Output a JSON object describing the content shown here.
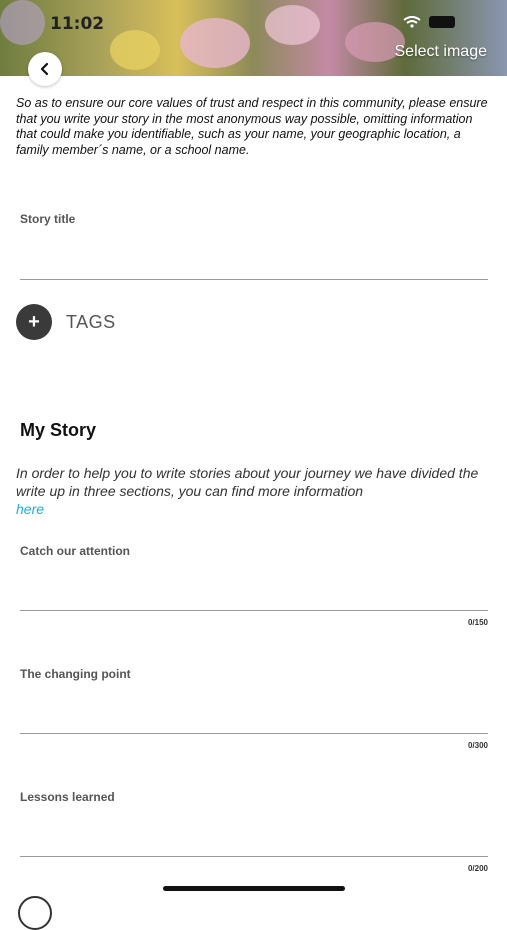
{
  "status_bar": {
    "time": "11:02"
  },
  "header": {
    "select_image_label": "Select image"
  },
  "intro_text": "So as to ensure our core values of trust and respect in this community, please ensure that you write your story in the most anonymous way possible, omitting information that could make you identifiable, such as your name, your geographic location, a family member´s name, or a school name.",
  "story_title": {
    "label": "Story title",
    "value": ""
  },
  "tags": {
    "label": "TAGS",
    "add_symbol": "+"
  },
  "my_story": {
    "heading": "My Story",
    "explanation": "In order to help you to write stories about your journey we have divided the write up in three sections, you can find more information",
    "link_text": "here"
  },
  "sections": [
    {
      "label": "Catch our attention",
      "counter": "0/150"
    },
    {
      "label": "The changing point",
      "counter": "0/300"
    },
    {
      "label": "Lessons learned",
      "counter": "0/200"
    }
  ],
  "colors": {
    "link": "#2aa7e0",
    "dark_button": "#3a3a3a"
  },
  "icons": {
    "back": "chevron-left-icon",
    "add": "plus-icon",
    "wifi": "wifi-icon",
    "battery": "battery-icon"
  }
}
